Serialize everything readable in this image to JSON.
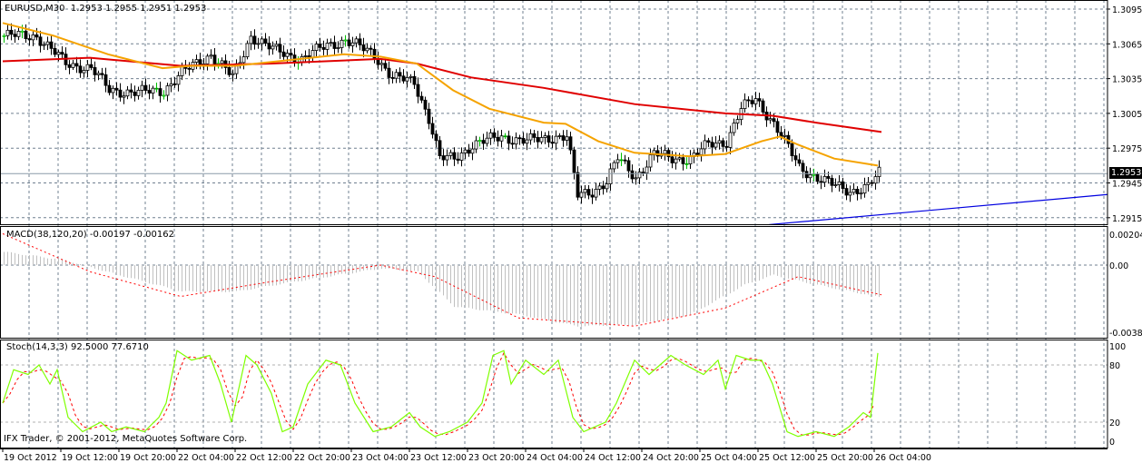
{
  "header": {
    "symbol": "EURUSD,M30",
    "open": "1.2953",
    "high": "1.2955",
    "low": "1.2951",
    "close": "1.2953"
  },
  "macd_label": "MACD(38,120,20) -0.00197 -0.00162",
  "stoch_label": "Stoch(14,3,3) 92.5000 77.6710",
  "copyright": "IFX Trader, © 2001-2012, MetaQuotes Software Corp.",
  "current_price": "1.2953",
  "colors": {
    "ma_fast": "#f5a300",
    "ma_slow": "#e00000",
    "trend": "#0000e0",
    "stoch_k": "#7fff00",
    "stoch_d": "#ff0000",
    "hist": "#c0c0c0",
    "grid": "#708090"
  },
  "chart_data": [
    {
      "type": "candlestick",
      "name": "price",
      "ylim": [
        1.2905,
        1.3105
      ],
      "y_ticks": [
        "1.3095",
        "1.3065",
        "1.3035",
        "1.3005",
        "1.2975",
        "1.2945",
        "1.2915"
      ],
      "x_ticks": [
        "19 Oct 2012",
        "19 Oct 12:00",
        "19 Oct 20:00",
        "22 Oct 04:00",
        "22 Oct 12:00",
        "22 Oct 20:00",
        "23 Oct 04:00",
        "23 Oct 12:00",
        "23 Oct 20:00",
        "24 Oct 04:00",
        "24 Oct 12:00",
        "24 Oct 20:00",
        "25 Oct 04:00",
        "25 Oct 12:00",
        "25 Oct 20:00",
        "26 Oct 04:00"
      ],
      "bars_per_tick": 16,
      "close_points": [
        [
          0,
          1.3072
        ],
        [
          9,
          1.3072
        ],
        [
          17,
          1.3048
        ],
        [
          24,
          1.3044
        ],
        [
          29,
          1.3025
        ],
        [
          37,
          1.3023
        ],
        [
          44,
          1.3025
        ],
        [
          49,
          1.304
        ],
        [
          57,
          1.3056
        ],
        [
          63,
          1.3036
        ],
        [
          68,
          1.3072
        ],
        [
          74,
          1.306
        ],
        [
          82,
          1.3052
        ],
        [
          89,
          1.3064
        ],
        [
          94,
          1.3068
        ],
        [
          102,
          1.3056
        ],
        [
          107,
          1.3036
        ],
        [
          113,
          1.3032
        ],
        [
          117,
          1.3001
        ],
        [
          120,
          1.2966
        ],
        [
          124,
          1.2966
        ],
        [
          129,
          1.2978
        ],
        [
          137,
          1.2985
        ],
        [
          144,
          1.2981
        ],
        [
          152,
          1.2985
        ],
        [
          155,
          1.2985
        ],
        [
          158,
          1.2934
        ],
        [
          162,
          1.2938
        ],
        [
          166,
          1.2946
        ],
        [
          169,
          1.2966
        ],
        [
          174,
          1.295
        ],
        [
          179,
          1.297
        ],
        [
          184,
          1.2966
        ],
        [
          189,
          1.2966
        ],
        [
          194,
          1.2978
        ],
        [
          199,
          1.2981
        ],
        [
          203,
          1.3009
        ],
        [
          207,
          1.3017
        ],
        [
          212,
          1.2997
        ],
        [
          215,
          1.2981
        ],
        [
          219,
          1.2958
        ],
        [
          224,
          1.295
        ],
        [
          229,
          1.2942
        ],
        [
          233,
          1.2938
        ],
        [
          238,
          1.2942
        ],
        [
          241,
          1.2953
        ]
      ],
      "ma_fast": [
        [
          0,
          1.3083
        ],
        [
          14,
          1.3072
        ],
        [
          29,
          1.3056
        ],
        [
          44,
          1.3044
        ],
        [
          52,
          1.3046
        ],
        [
          64,
          1.3046
        ],
        [
          82,
          1.3052
        ],
        [
          94,
          1.3056
        ],
        [
          104,
          1.3054
        ],
        [
          114,
          1.3048
        ],
        [
          124,
          1.3025
        ],
        [
          134,
          1.3009
        ],
        [
          149,
          1.2997
        ],
        [
          155,
          1.2996
        ],
        [
          164,
          1.2981
        ],
        [
          174,
          1.2971
        ],
        [
          189,
          1.2968
        ],
        [
          199,
          1.297
        ],
        [
          209,
          1.2981
        ],
        [
          214,
          1.2985
        ],
        [
          219,
          1.2978
        ],
        [
          229,
          1.2966
        ],
        [
          241,
          1.296
        ]
      ],
      "ma_slow": [
        [
          0,
          1.305
        ],
        [
          24,
          1.3053
        ],
        [
          49,
          1.3046
        ],
        [
          74,
          1.3048
        ],
        [
          104,
          1.3052
        ],
        [
          114,
          1.3048
        ],
        [
          129,
          1.3036
        ],
        [
          149,
          1.3027
        ],
        [
          174,
          1.3013
        ],
        [
          199,
          1.3005
        ],
        [
          212,
          1.3003
        ],
        [
          224,
          1.2997
        ],
        [
          242,
          1.2989
        ]
      ],
      "trendline": [
        [
          211,
          1.2909
        ],
        [
          304,
          1.2935
        ]
      ]
    },
    {
      "type": "macd",
      "ylim": [
        -0.00382,
        0.00204
      ],
      "y_ticks": [
        "0.00204",
        "0.00",
        "-0.00382"
      ],
      "histogram": [
        [
          0,
          0.0008
        ],
        [
          17,
          0.0003
        ],
        [
          30,
          -0.0005
        ],
        [
          49,
          -0.0016
        ],
        [
          64,
          -0.0016
        ],
        [
          80,
          -0.001
        ],
        [
          104,
          -0.0002
        ],
        [
          114,
          -0.0004
        ],
        [
          124,
          -0.0025
        ],
        [
          142,
          -0.003
        ],
        [
          158,
          -0.0037
        ],
        [
          174,
          -0.0036
        ],
        [
          189,
          -0.003
        ],
        [
          204,
          -0.0012
        ],
        [
          212,
          -0.0006
        ],
        [
          224,
          -0.0012
        ],
        [
          242,
          -0.00197
        ]
      ],
      "signal": [
        [
          0,
          0.0019
        ],
        [
          24,
          -0.0004
        ],
        [
          49,
          -0.0019
        ],
        [
          74,
          -0.001
        ],
        [
          104,
          0
        ],
        [
          119,
          -0.0007
        ],
        [
          142,
          -0.0032
        ],
        [
          174,
          -0.0037
        ],
        [
          199,
          -0.0026
        ],
        [
          219,
          -0.0007
        ],
        [
          242,
          -0.0018
        ]
      ]
    },
    {
      "type": "stochastic",
      "ylim": [
        0,
        100
      ],
      "y_ticks": [
        "100",
        "80",
        "20",
        "0"
      ],
      "k": [
        [
          0,
          40
        ],
        [
          3,
          75
        ],
        [
          7,
          70
        ],
        [
          10,
          80
        ],
        [
          13,
          60
        ],
        [
          15,
          75
        ],
        [
          18,
          25
        ],
        [
          22,
          10
        ],
        [
          27,
          20
        ],
        [
          30,
          10
        ],
        [
          34,
          15
        ],
        [
          39,
          10
        ],
        [
          43,
          25
        ],
        [
          45,
          40
        ],
        [
          48,
          95
        ],
        [
          52,
          85
        ],
        [
          57,
          90
        ],
        [
          60,
          60
        ],
        [
          63,
          20
        ],
        [
          67,
          90
        ],
        [
          70,
          80
        ],
        [
          74,
          50
        ],
        [
          77,
          10
        ],
        [
          80,
          15
        ],
        [
          84,
          60
        ],
        [
          89,
          85
        ],
        [
          93,
          80
        ],
        [
          97,
          40
        ],
        [
          102,
          10
        ],
        [
          107,
          15
        ],
        [
          112,
          30
        ],
        [
          115,
          15
        ],
        [
          119,
          5
        ],
        [
          123,
          10
        ],
        [
          128,
          20
        ],
        [
          132,
          40
        ],
        [
          135,
          90
        ],
        [
          138,
          95
        ],
        [
          140,
          60
        ],
        [
          144,
          85
        ],
        [
          149,
          70
        ],
        [
          153,
          85
        ],
        [
          157,
          25
        ],
        [
          160,
          10
        ],
        [
          166,
          20
        ],
        [
          169,
          40
        ],
        [
          174,
          85
        ],
        [
          178,
          70
        ],
        [
          184,
          90
        ],
        [
          188,
          80
        ],
        [
          193,
          70
        ],
        [
          197,
          85
        ],
        [
          199,
          55
        ],
        [
          202,
          90
        ],
        [
          206,
          85
        ],
        [
          209,
          85
        ],
        [
          212,
          60
        ],
        [
          216,
          10
        ],
        [
          219,
          5
        ],
        [
          224,
          10
        ],
        [
          229,
          5
        ],
        [
          233,
          15
        ],
        [
          237,
          30
        ],
        [
          239,
          25
        ],
        [
          241,
          92.5
        ]
      ]
    }
  ]
}
